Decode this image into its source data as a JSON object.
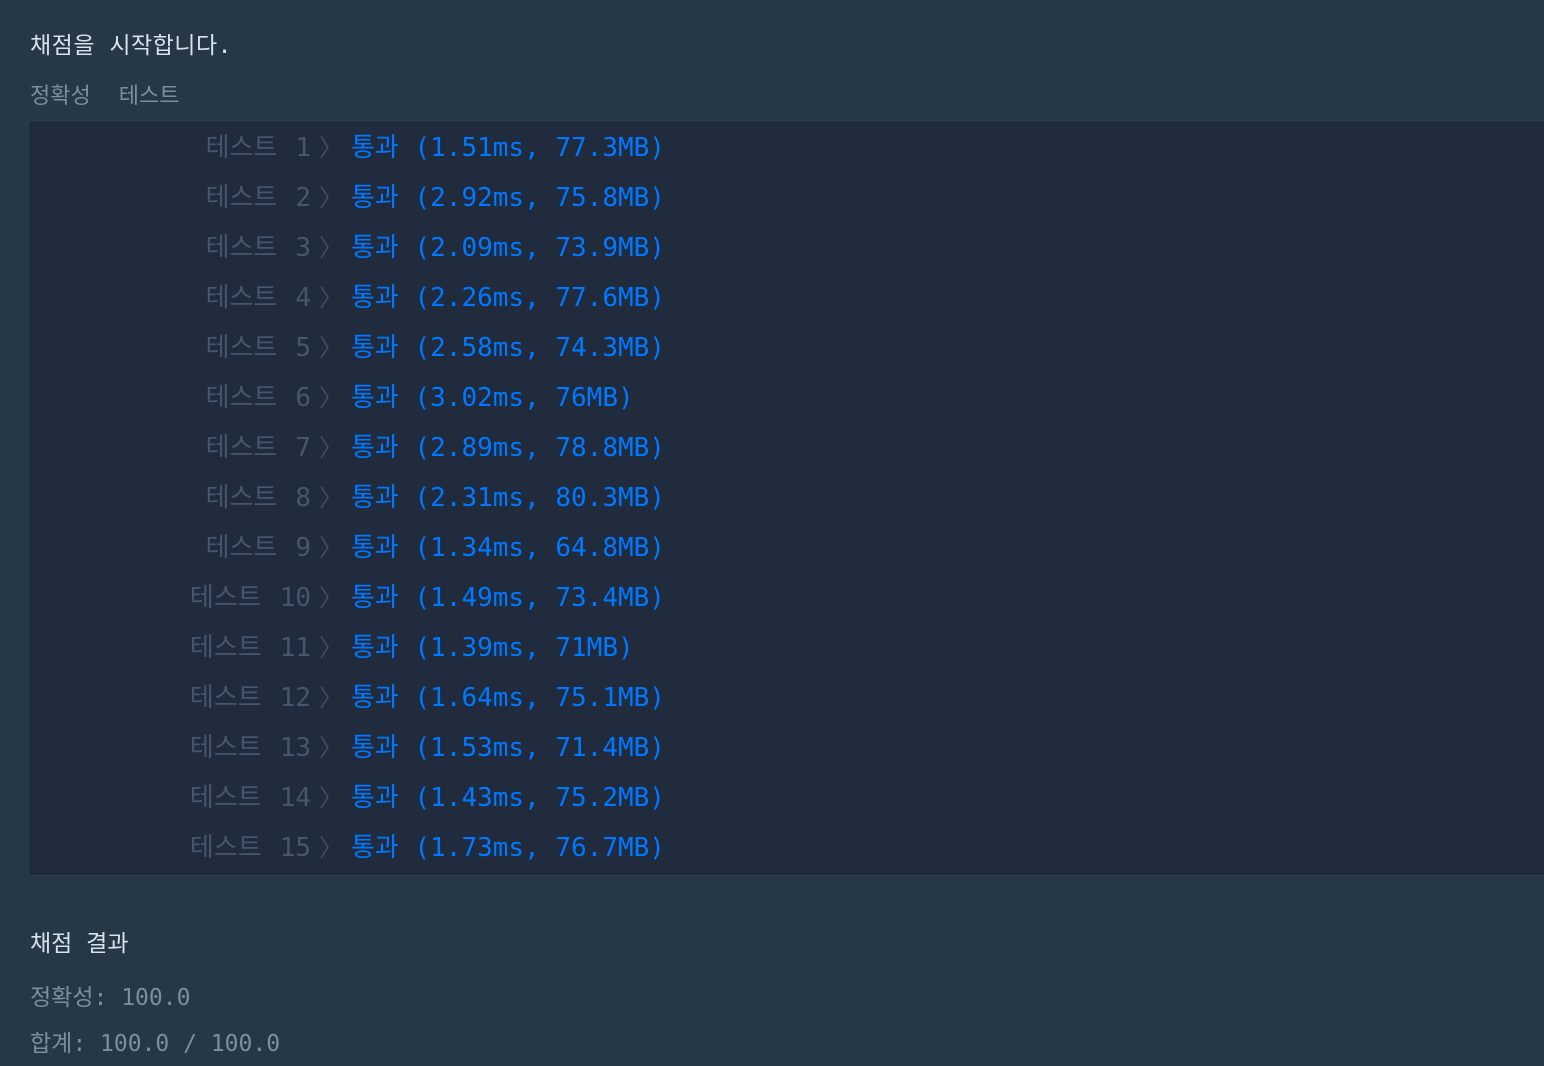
{
  "header": {
    "start_message": "채점을 시작합니다.",
    "section_label": "정확성",
    "section_label_2": "테스트"
  },
  "tests": [
    {
      "name": "테스트",
      "num": "1",
      "status": "통과",
      "detail": "(1.51ms, 77.3MB)"
    },
    {
      "name": "테스트",
      "num": "2",
      "status": "통과",
      "detail": "(2.92ms, 75.8MB)"
    },
    {
      "name": "테스트",
      "num": "3",
      "status": "통과",
      "detail": "(2.09ms, 73.9MB)"
    },
    {
      "name": "테스트",
      "num": "4",
      "status": "통과",
      "detail": "(2.26ms, 77.6MB)"
    },
    {
      "name": "테스트",
      "num": "5",
      "status": "통과",
      "detail": "(2.58ms, 74.3MB)"
    },
    {
      "name": "테스트",
      "num": "6",
      "status": "통과",
      "detail": "(3.02ms, 76MB)"
    },
    {
      "name": "테스트",
      "num": "7",
      "status": "통과",
      "detail": "(2.89ms, 78.8MB)"
    },
    {
      "name": "테스트",
      "num": "8",
      "status": "통과",
      "detail": "(2.31ms, 80.3MB)"
    },
    {
      "name": "테스트",
      "num": "9",
      "status": "통과",
      "detail": "(1.34ms, 64.8MB)"
    },
    {
      "name": "테스트",
      "num": "10",
      "status": "통과",
      "detail": "(1.49ms, 73.4MB)"
    },
    {
      "name": "테스트",
      "num": "11",
      "status": "통과",
      "detail": "(1.39ms, 71MB)"
    },
    {
      "name": "테스트",
      "num": "12",
      "status": "통과",
      "detail": "(1.64ms, 75.1MB)"
    },
    {
      "name": "테스트",
      "num": "13",
      "status": "통과",
      "detail": "(1.53ms, 71.4MB)"
    },
    {
      "name": "테스트",
      "num": "14",
      "status": "통과",
      "detail": "(1.43ms, 75.2MB)"
    },
    {
      "name": "테스트",
      "num": "15",
      "status": "통과",
      "detail": "(1.73ms, 76.7MB)"
    }
  ],
  "summary": {
    "title": "채점 결과",
    "accuracy_label": "정확성:",
    "accuracy_value": "100.0",
    "total_label": "합계:",
    "total_value": "100.0 / 100.0"
  },
  "colors": {
    "background": "#263747",
    "panel": "#202b3d",
    "pass": "#0078ff",
    "muted": "#44576c"
  },
  "icons": {
    "chevron": "chevron-right-icon"
  }
}
